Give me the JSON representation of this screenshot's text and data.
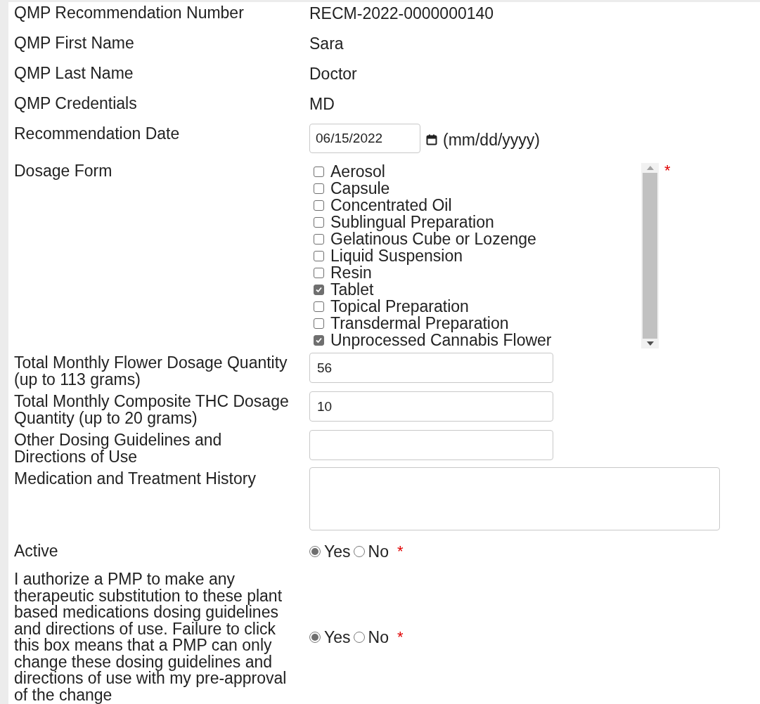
{
  "fields": [
    {
      "kind": "text",
      "label": "QMP Recommendation Number",
      "value": "RECM-2022-0000000140"
    },
    {
      "kind": "text",
      "label": "QMP First Name",
      "value": "Sara"
    },
    {
      "kind": "text",
      "label": "QMP Last Name",
      "value": "Doctor"
    },
    {
      "kind": "text",
      "label": "QMP Credentials",
      "value": "MD"
    },
    {
      "kind": "date",
      "label": "Recommendation Date",
      "value": "06/15/2022",
      "hint": "(mm/dd/yyyy)"
    },
    {
      "kind": "checklist",
      "label": "Dosage Form",
      "required_mark": "*",
      "options": [
        {
          "label": "Aerosol",
          "checked": false
        },
        {
          "label": "Capsule",
          "checked": false
        },
        {
          "label": "Concentrated Oil",
          "checked": false
        },
        {
          "label": "Sublingual Preparation",
          "checked": false
        },
        {
          "label": "Gelatinous Cube or Lozenge",
          "checked": false
        },
        {
          "label": "Liquid Suspension",
          "checked": false
        },
        {
          "label": "Resin",
          "checked": false
        },
        {
          "label": "Tablet",
          "checked": true
        },
        {
          "label": "Topical Preparation",
          "checked": false
        },
        {
          "label": "Transdermal Preparation",
          "checked": false
        },
        {
          "label": "Unprocessed Cannabis Flower",
          "checked": true
        }
      ]
    },
    {
      "kind": "input",
      "label": "Total Monthly Flower Dosage Quantity (up to 113 grams)",
      "value": "56"
    },
    {
      "kind": "input",
      "label": "Total Monthly Composite THC Dosage Quantity (up to 20 grams)",
      "value": "10"
    },
    {
      "kind": "input",
      "label": "Other Dosing Guidelines and Directions of Use"
    },
    {
      "kind": "textarea",
      "label": "Medication and Treatment History"
    },
    {
      "kind": "radio",
      "label": "Active",
      "required_mark": "*",
      "options": [
        {
          "label": "Yes",
          "selected": true
        },
        {
          "label": "No",
          "selected": false
        }
      ]
    },
    {
      "kind": "radio",
      "label": "I authorize a PMP to make any therapeutic substitution to these plant based medications dosing guidelines and directions of use. Failure to click this box means that a PMP can only change these dosing guidelines and directions of use with my pre-approval of the change",
      "required_mark": "*",
      "options": [
        {
          "label": "Yes",
          "selected": true
        },
        {
          "label": "No",
          "selected": false
        }
      ]
    }
  ]
}
